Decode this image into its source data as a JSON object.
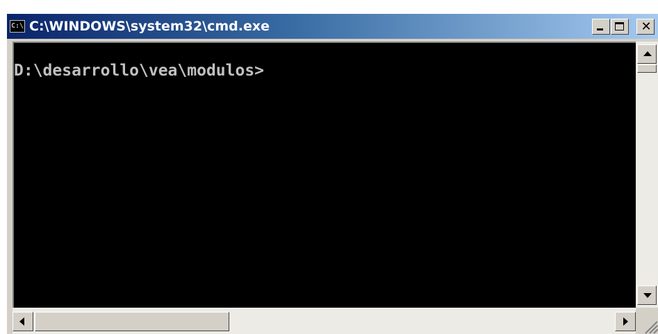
{
  "window": {
    "title": "C:\\WINDOWS\\system32\\cmd.exe",
    "icon": "cmd-icon",
    "icon_text": "C:\\",
    "buttons": {
      "minimize": "minimize-icon",
      "maximize": "maximize-icon",
      "close": "close-icon",
      "close_glyph": "✕"
    },
    "colors": {
      "titlebar_start": "#0a246a",
      "titlebar_end": "#a6caf0",
      "console_bg": "#000000",
      "console_text": "#c0c0c0",
      "frame": "#d4d0c8"
    }
  },
  "console": {
    "prompt": "D:\\desarrollo\\vea\\modulos>"
  },
  "scrollbars": {
    "vertical": {
      "up_icon": "arrow-up-icon",
      "down_icon": "arrow-down-icon",
      "position": 0
    },
    "horizontal": {
      "left_icon": "arrow-left-icon",
      "right_icon": "arrow-right-icon",
      "position": 0
    }
  }
}
